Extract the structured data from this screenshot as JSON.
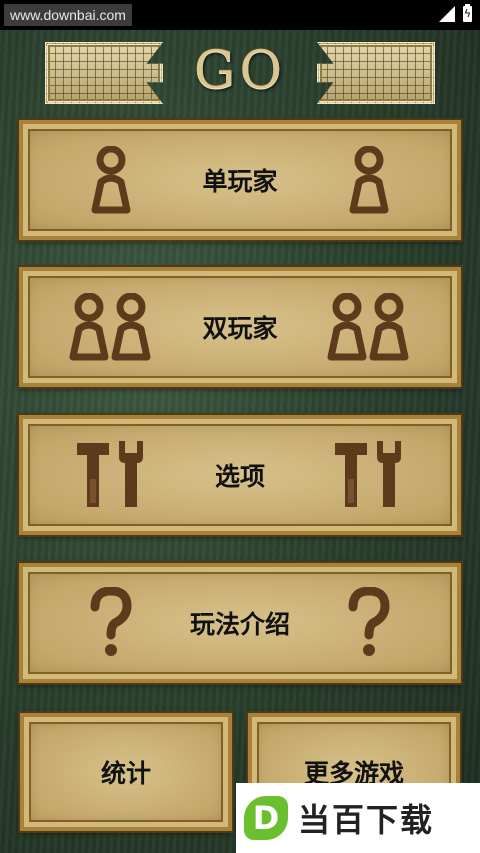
{
  "status_bar": {
    "watermark_url": "www.downbai.com",
    "icons": [
      "signal-icon",
      "battery-charging-icon"
    ]
  },
  "header": {
    "title": "GO",
    "decorations": [
      "go-board-ornament-left",
      "go-board-ornament-right"
    ]
  },
  "menu": {
    "items": [
      {
        "id": "single-player",
        "label": "单玩家",
        "icon": "single-person-icon"
      },
      {
        "id": "two-player",
        "label": "双玩家",
        "icon": "two-persons-icon"
      },
      {
        "id": "options",
        "label": "选项",
        "icon": "tools-icon"
      },
      {
        "id": "how-to-play",
        "label": "玩法介绍",
        "icon": "question-mark-icon"
      }
    ],
    "bottom": [
      {
        "id": "statistics",
        "label": "统计"
      },
      {
        "id": "more-games",
        "label": "更多游戏"
      }
    ]
  },
  "promo_overlay": {
    "logo_letter": "D",
    "text": "当百下载"
  },
  "colors": {
    "background": "#2c4230",
    "panel": "#c9ad70",
    "panel_border": "#a6823b",
    "icon": "#5e3a1c",
    "label": "#111111",
    "promo_green": "#6bbf2e"
  }
}
